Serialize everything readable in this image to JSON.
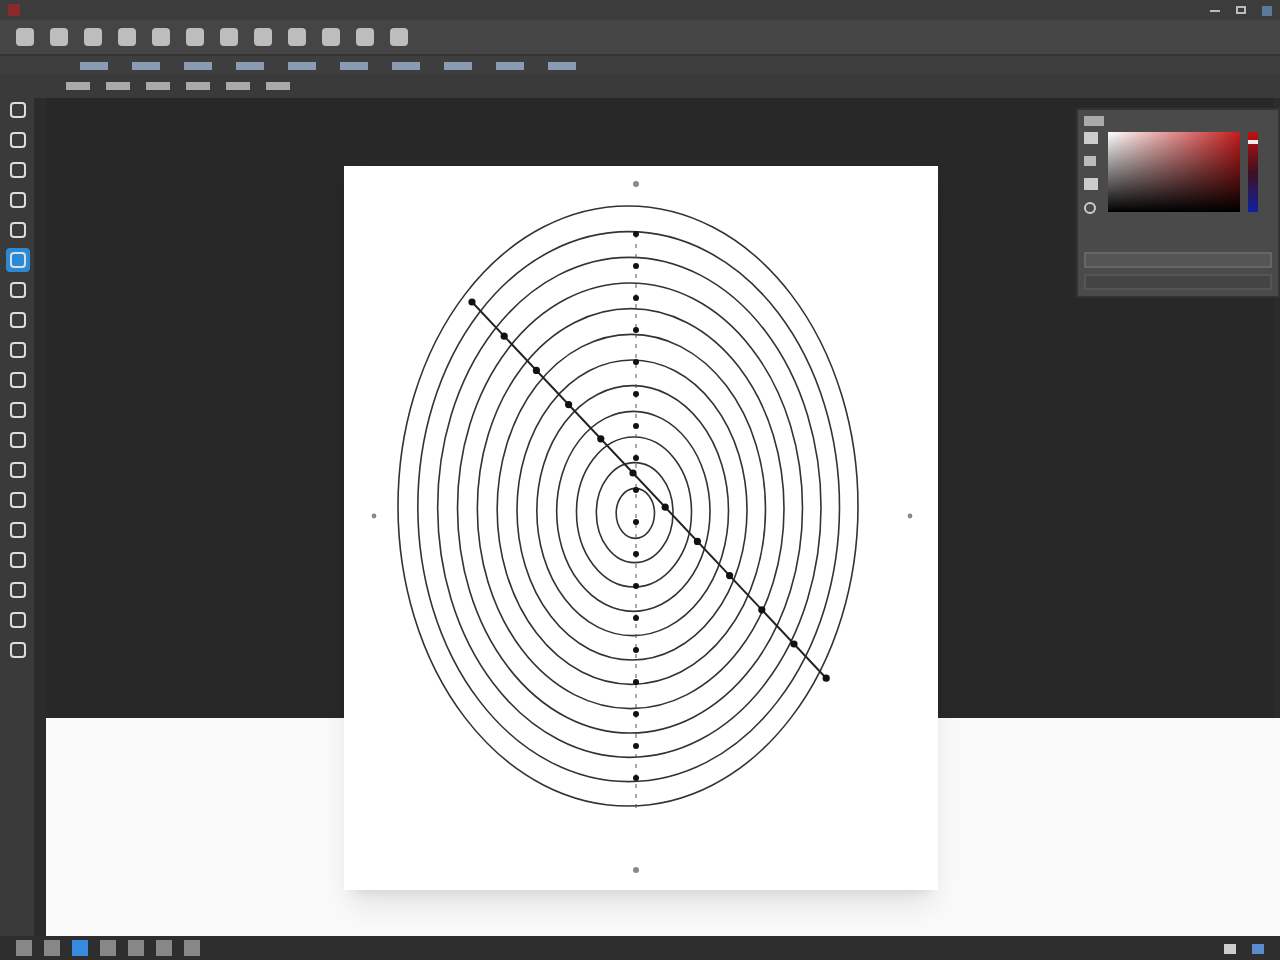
{
  "tools": [
    {
      "selected": false
    },
    {
      "selected": false
    },
    {
      "selected": false
    },
    {
      "selected": false
    },
    {
      "selected": false
    },
    {
      "selected": true
    },
    {
      "selected": false
    },
    {
      "selected": false
    },
    {
      "selected": false
    },
    {
      "selected": false
    },
    {
      "selected": false
    },
    {
      "selected": false
    },
    {
      "selected": false
    },
    {
      "selected": false
    },
    {
      "selected": false
    },
    {
      "selected": false
    },
    {
      "selected": false
    },
    {
      "selected": false
    },
    {
      "selected": false
    }
  ],
  "hue_slider": {
    "level": 0.9
  },
  "taskbar_apps": [
    {
      "selected": false
    },
    {
      "selected": false
    },
    {
      "selected": true
    },
    {
      "selected": false
    },
    {
      "selected": false
    },
    {
      "selected": false
    },
    {
      "selected": false
    }
  ]
}
